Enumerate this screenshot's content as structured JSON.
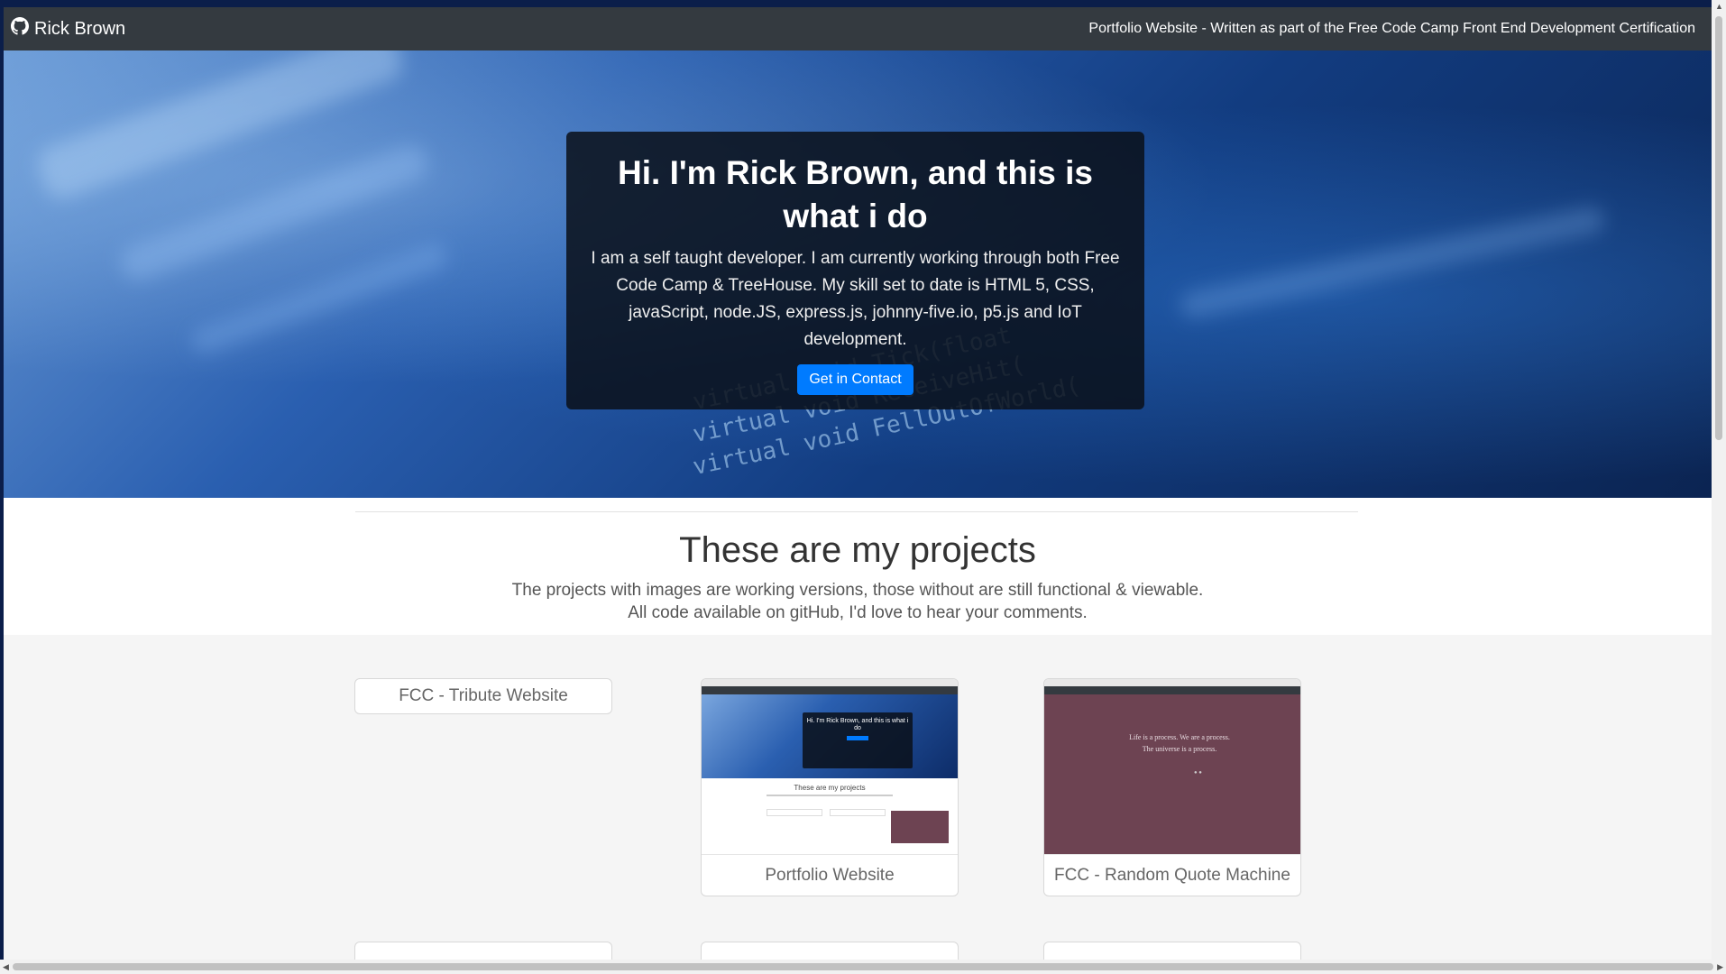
{
  "navbar": {
    "brand": "Rick Brown",
    "tagline": "Portfolio Website - Written as part of the Free Code Camp Front End Development Certification"
  },
  "hero": {
    "title": "Hi. I'm Rick Brown, and this is what i do",
    "description": "I am a self taught developer. I am currently working through both Free Code Camp & TreeHouse. My skill set to date is HTML 5, CSS, javaScript, node.JS, express.js, johnny-five.io, p5.js and IoT development.",
    "contact_button": "Get in Contact"
  },
  "projects": {
    "title": "These are my projects",
    "subtitle_line1": "The projects with images are working versions, those without are still functional & viewable.",
    "subtitle_line2": "All code available on gitHub, I'd love to hear your comments.",
    "cards": [
      {
        "label": "FCC - Tribute Website"
      },
      {
        "label": "Portfolio Website"
      },
      {
        "label": "FCC - Random Quote Machine"
      }
    ]
  },
  "thumbnails": {
    "portfolio_hero": "Hi. I'm Rick Brown, and this is what i do",
    "portfolio_title": "These are my projects",
    "quote_text": "Life is a process. We are a process. The universe is a process."
  },
  "colors": {
    "navbar": "#343a40",
    "button": "#007bff",
    "quote_bg": "#6d4352"
  }
}
